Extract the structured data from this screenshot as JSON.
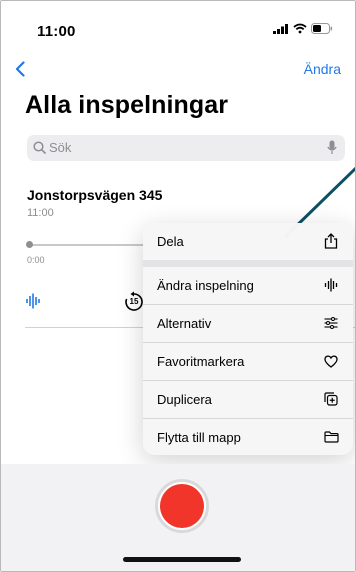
{
  "status_bar": {
    "time": "11:00"
  },
  "nav": {
    "back_icon": "chevron-left-icon",
    "edit_label": "Ändra"
  },
  "page": {
    "title": "Alla inspelningar"
  },
  "search": {
    "placeholder": "Sök",
    "search_icon": "magnifier-icon",
    "mic_icon": "mic-icon"
  },
  "recording": {
    "title": "Jonstorpsvägen 345",
    "time": "11:00",
    "position_label": "0:00",
    "skip_back_seconds": "15"
  },
  "context_menu": {
    "items": [
      {
        "label": "Dela",
        "icon": "share-icon"
      },
      {
        "label": "Ändra inspelning",
        "icon": "waveform-icon"
      },
      {
        "label": "Alternativ",
        "icon": "sliders-icon"
      },
      {
        "label": "Favoritmarkera",
        "icon": "heart-icon"
      },
      {
        "label": "Duplicera",
        "icon": "duplicate-icon"
      },
      {
        "label": "Flytta till mapp",
        "icon": "folder-icon"
      }
    ]
  },
  "colors": {
    "accent": "#1f7ae8",
    "record": "#f2352b",
    "annotation_line": "#0d4f63"
  }
}
